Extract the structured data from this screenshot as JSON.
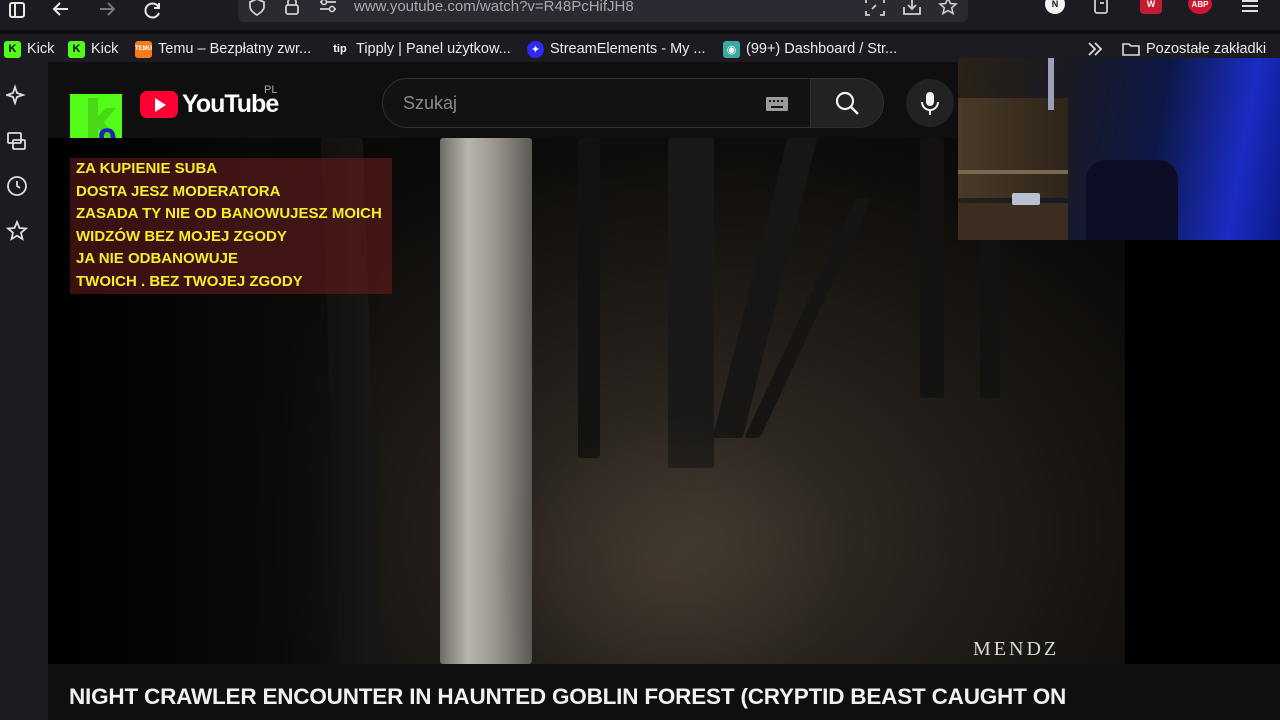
{
  "browser": {
    "url": "www.youtube.com/watch?v=R48PcHifJH8",
    "extensions": [
      {
        "icon": "n-extension-icon",
        "label": "N"
      },
      {
        "icon": "abp-extension-icon",
        "label": "ABP"
      }
    ]
  },
  "bookmarks": {
    "items": [
      {
        "label": "Kick",
        "icon": "kick-icon"
      },
      {
        "label": "Kick",
        "icon": "kick-icon"
      },
      {
        "label": "Temu – Bezpłatny zwr...",
        "icon": "temu-icon"
      },
      {
        "label": "Tipply | Panel użytkow...",
        "icon": "tipply-icon"
      },
      {
        "label": "StreamElements - My ...",
        "icon": "streamelements-icon"
      },
      {
        "label": "(99+) Dashboard / Str...",
        "icon": "discord-icon"
      }
    ],
    "other_label": "Pozostałe zakładki"
  },
  "youtube": {
    "logo_text": "YouTube",
    "region": "PL",
    "search_placeholder": "Szukaj"
  },
  "overlay": {
    "lines": [
      "ZA KUPIENIE SUBA",
      "DOSTA JESZ MODERATORA",
      "ZASADA  TY NIE OD BANOWUJESZ MOICH",
      "WIDZÓW BEZ MOJEJ ZGODY",
      "JA NIE ODBANOWUJE",
      "TWOICH . BEZ TWOJEJ ZGODY"
    ],
    "text_color": "#f4ee2a"
  },
  "video": {
    "watermark": "MENDZ",
    "title": "NIGHT CRAWLER ENCOUNTER IN HAUNTED GOBLIN FOREST (CRYPTID BEAST CAUGHT ON"
  },
  "colors": {
    "browser_chrome": "#1c1b22",
    "youtube_red": "#ff0033",
    "kick_green": "#53fc18"
  }
}
